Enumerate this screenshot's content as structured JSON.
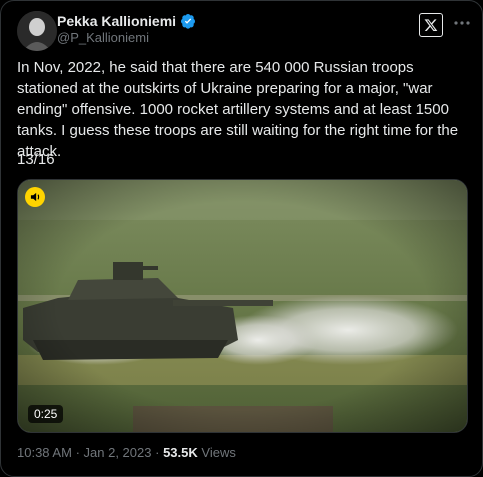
{
  "author": {
    "display_name": "Pekka Kallioniemi",
    "handle": "@P_Kallioniemi",
    "verified": true,
    "verified_color": "#1d9bf0"
  },
  "tweet": {
    "text": "In Nov, 2022, he said that there are 540 000 Russian troops stationed at the outskirts of Ukraine preparing for a major, \"war ending\" offensive. 1000 rocket artillery systems and at least 1500 tanks. I guess these troops are still waiting for the right time for the attack.",
    "thread_counter": "13/16"
  },
  "media": {
    "type": "video",
    "duration": "0:25",
    "audio_badge_icon": "speaker-icon",
    "audio_badge_color": "#ffd400"
  },
  "footer": {
    "time": "10:38 AM",
    "separator": "·",
    "date": "Jan 2, 2023",
    "views_count": "53.5K",
    "views_label": "Views"
  },
  "icons": {
    "x_logo": "x-logo-icon",
    "more": "more-options-icon"
  },
  "colors": {
    "background": "#000000",
    "text": "#e7e9ea",
    "secondary_text": "#71767b",
    "border": "#2f3336"
  }
}
